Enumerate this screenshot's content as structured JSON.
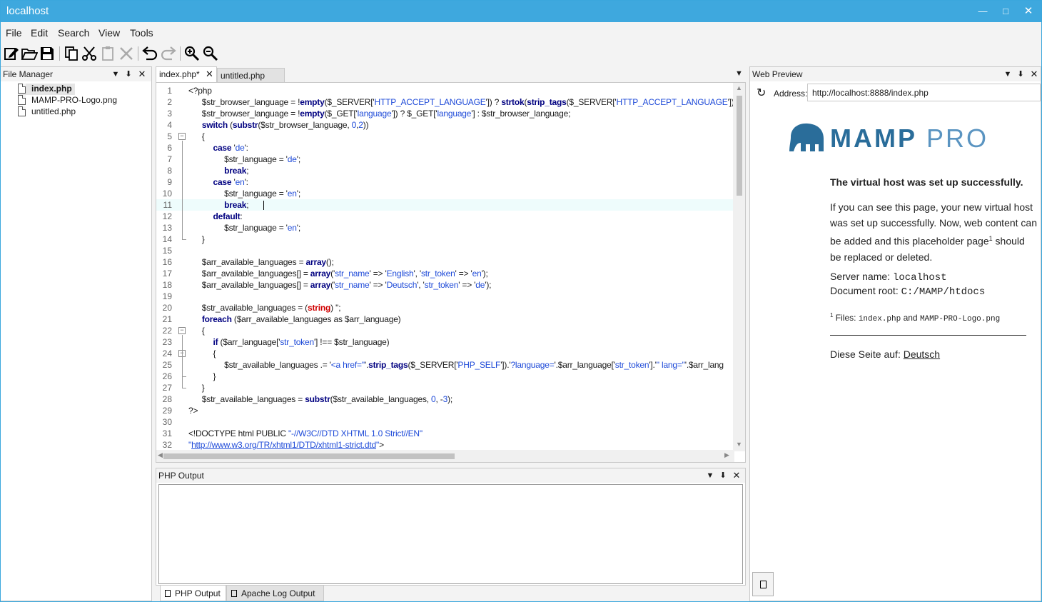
{
  "window": {
    "title": "localhost"
  },
  "menu": [
    "File",
    "Edit",
    "Search",
    "View",
    "Tools"
  ],
  "toolbar": {
    "icons": [
      "new-icon",
      "open-icon",
      "save-icon",
      "copy-icon",
      "cut-icon",
      "paste-icon",
      "delete-icon",
      "undo-icon",
      "redo-icon",
      "zoom-in-icon",
      "zoom-out-icon"
    ]
  },
  "file_manager": {
    "title": "File Manager",
    "files": [
      "index.php",
      "MAMP-PRO-Logo.png",
      "untitled.php"
    ]
  },
  "editor": {
    "tabs": [
      "index.php*",
      "untitled.php"
    ],
    "lines": [
      "<?php",
      "    $str_browser_language = !empty($_SERVER['HTTP_ACCEPT_LANGUAGE']) ? strtok(strip_tags($_SERVER['HTTP_ACCEPT_LANGUAGE']), ',') : '';",
      "    $str_browser_language = !empty($_GET['language']) ? $_GET['language'] : $str_browser_language;",
      "    switch (substr($str_browser_language, 0,2))",
      "    {",
      "        case 'de':",
      "            $str_language = 'de';",
      "            break;",
      "        case 'en':",
      "            $str_language = 'en';",
      "            break;",
      "        default:",
      "            $str_language = 'en';",
      "    }",
      "",
      "    $arr_available_languages = array();",
      "    $arr_available_languages[] = array('str_name' => 'English', 'str_token' => 'en');",
      "    $arr_available_languages[] = array('str_name' => 'Deutsch', 'str_token' => 'de');",
      "",
      "    $str_available_languages = (string) '';",
      "    foreach ($arr_available_languages as $arr_language)",
      "    {",
      "        if ($arr_language['str_token'] !== $str_language)",
      "        {",
      "            $str_available_languages .= '<a href=\"'.strip_tags($_SERVER['PHP_SELF']).'?language='.$arr_language['str_token'].'\" lang=\"'.$arr_lang",
      "        }",
      "    }",
      "    $str_available_languages = substr($str_available_languages, 0, -3);",
      "?>",
      "",
      "<!DOCTYPE html PUBLIC \"-//W3C//DTD XHTML 1.0 Strict//EN\"",
      "\"http://www.w3.org/TR/xhtml1/DTD/xhtml1-strict.dtd\">"
    ],
    "current_line": 11
  },
  "php_output": {
    "title": "PHP Output",
    "tabs": [
      "PHP Output",
      "Apache Log Output"
    ]
  },
  "web_preview": {
    "title": "Web Preview",
    "address_label": "Address:",
    "address": "http://localhost:8888/index.php",
    "logo_text_a": "MAMP",
    "logo_text_b": "PRO",
    "heading": "The virtual host was set up successfully.",
    "para": "If you can see this page, your new virtual host was set up successfully. Now, web content can be added and this placeholder page",
    "para_sup": "1",
    "para_end": "should be replaced or deleted.",
    "server_name_label": "Server name:",
    "server_name": "localhost",
    "doc_root_label": "Document root:",
    "doc_root": "C:/MAMP/htdocs",
    "footnote_mark": "1",
    "footnote_label": "Files:",
    "footnote_file1": "index.php",
    "footnote_and": "and",
    "footnote_file2": "MAMP-PRO-Logo.png",
    "lang_label": "Diese Seite auf:",
    "lang_link": "Deutsch"
  },
  "colors": {
    "titlebar": "#3ea8de",
    "keyword": "#000080",
    "string": "#1e4ad8",
    "cast": "#d00000",
    "mamp_logo": "#2a6d9a"
  }
}
